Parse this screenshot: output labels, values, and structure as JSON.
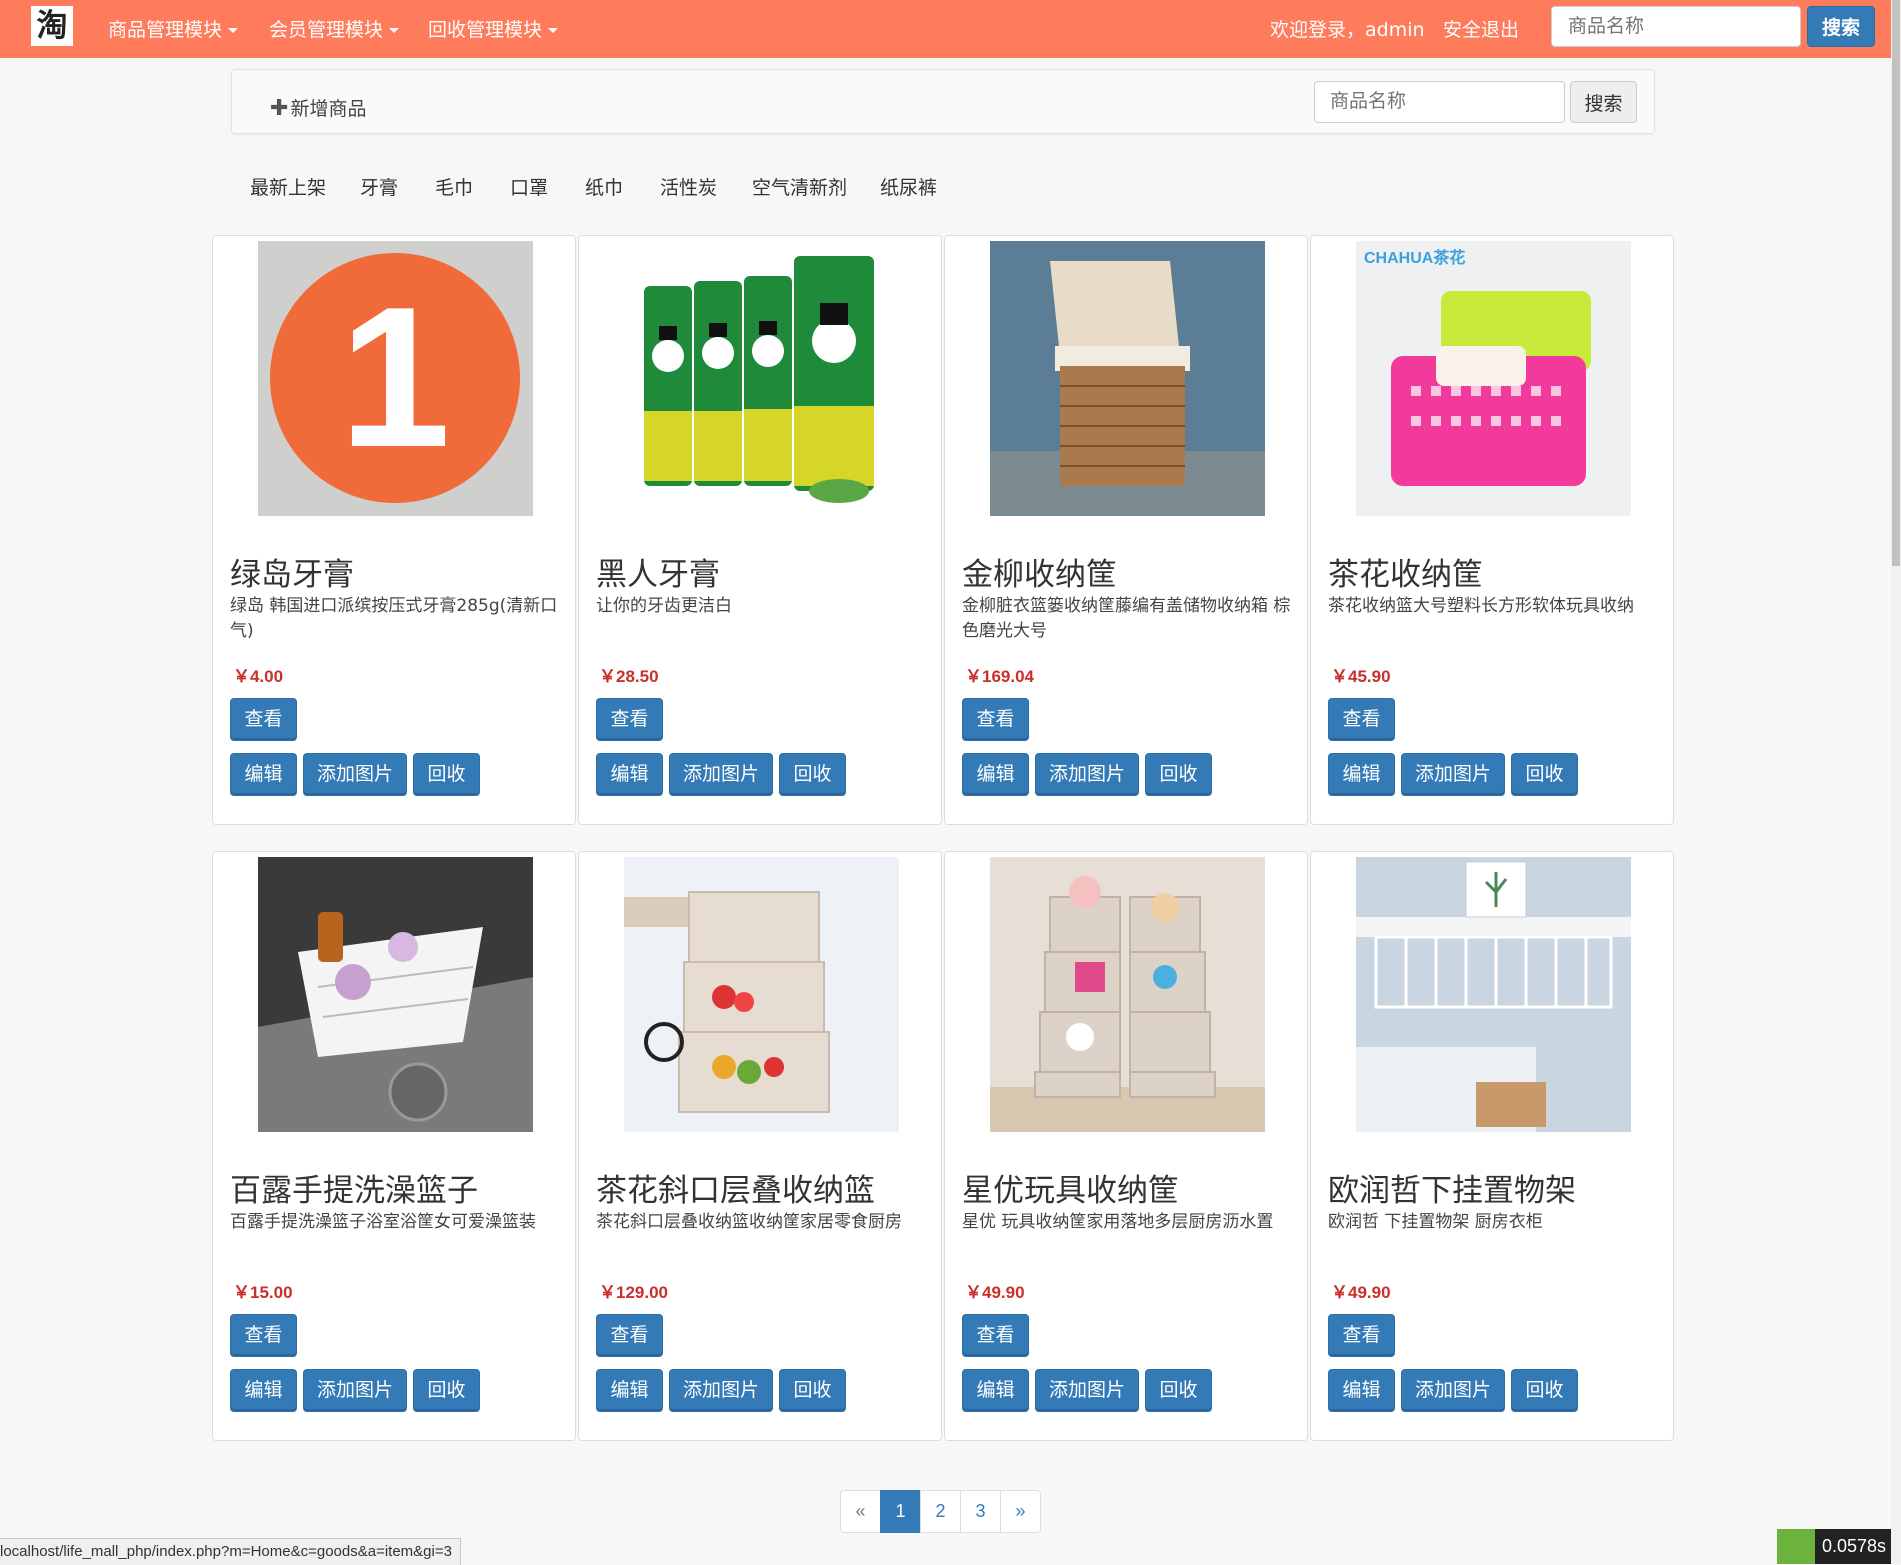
{
  "navbar": {
    "logo_char": "淘",
    "menus": [
      "商品管理模块",
      "会员管理模块",
      "回收管理模块"
    ],
    "welcome": "欢迎登录，admin",
    "logout": "安全退出",
    "search_placeholder": "商品名称",
    "search_button": "搜索"
  },
  "toolbar": {
    "add_label": "新增商品",
    "search_placeholder": "商品名称",
    "search_button": "搜索"
  },
  "categories": [
    "最新上架",
    "牙膏",
    "毛巾",
    "口罩",
    "纸巾",
    "活性炭",
    "空气清新剂",
    "纸尿裤"
  ],
  "buttons": {
    "view": "查看",
    "edit": "编辑",
    "add_image": "添加图片",
    "recycle": "回收"
  },
  "products": [
    {
      "title": "绿岛牙膏",
      "desc": "绿岛 韩国进口派缤按压式牙膏285g(清新口气)",
      "price": "￥4.00",
      "image_icon": "orange-number-one-icon"
    },
    {
      "title": "黑人牙膏",
      "desc": "让你的牙齿更洁白",
      "price": "￥28.50",
      "image_icon": "toothpaste-tubes-icon"
    },
    {
      "title": "金柳收纳筐",
      "desc": "金柳脏衣篮篓收纳筐藤编有盖储物收纳箱 棕色磨光大号",
      "price": "￥169.04",
      "image_icon": "wicker-basket-icon"
    },
    {
      "title": "茶花收纳筐",
      "desc": "茶花收纳篮大号塑料长方形软体玩具收纳",
      "price": "￥45.90",
      "image_icon": "plastic-basket-icon",
      "image_brand": "CHAHUA茶花"
    },
    {
      "title": "百露手提洗澡篮子",
      "desc": "百露手提洗澡篮子浴室浴筐女可爱澡篮装",
      "price": "￥15.00",
      "image_icon": "shower-caddy-icon"
    },
    {
      "title": "茶花斜口层叠收纳篮",
      "desc": "茶花斜口层叠收纳篮收纳筐家居零食厨房",
      "price": "￥129.00",
      "image_icon": "stacking-rack-icon"
    },
    {
      "title": "星优玩具收纳筐",
      "desc": "星优 玩具收纳筐家用落地多层厨房沥水置",
      "price": "￥49.90",
      "image_icon": "toy-shelf-icon"
    },
    {
      "title": "欧润哲下挂置物架",
      "desc": "欧润哲 下挂置物架 厨房衣柜",
      "price": "￥49.90",
      "image_icon": "under-shelf-basket-icon"
    }
  ],
  "pagination": {
    "prev": "«",
    "pages": [
      "1",
      "2",
      "3"
    ],
    "next": "»",
    "active": "1"
  },
  "status_url": "localhost/life_mall_php/index.php?m=Home&c=goods&a=item&gi=3",
  "timer": "0.0578s",
  "colors": {
    "navbar": "#fe7b5b",
    "primary": "#337ab7",
    "price": "#c9302c"
  }
}
